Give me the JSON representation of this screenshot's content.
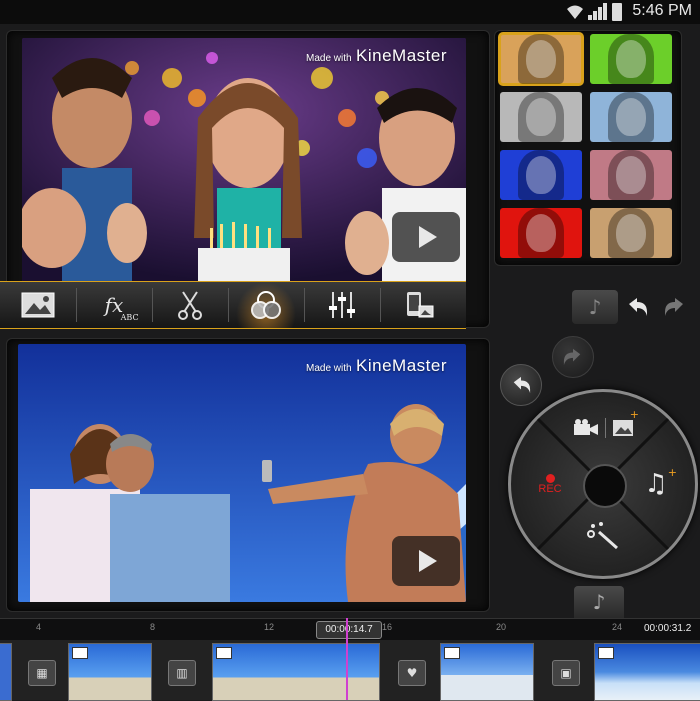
{
  "status_bar": {
    "time": "5:46 PM",
    "icons": [
      "wifi-icon",
      "signal-icon",
      "battery-icon"
    ]
  },
  "top_preview": {
    "watermark_small": "Made with",
    "watermark_brand": "KineMaster",
    "play_icon": "play-icon"
  },
  "bottom_preview": {
    "watermark_small": "Made with",
    "watermark_brand": "KineMaster",
    "play_icon": "play-icon"
  },
  "color_filters": [
    {
      "name": "original",
      "color": "#d9a25a",
      "selected": true
    },
    {
      "name": "green",
      "color": "#6ccf2a"
    },
    {
      "name": "grayscale",
      "color": "#b8b8b8"
    },
    {
      "name": "light-blue",
      "color": "#8fb4d9"
    },
    {
      "name": "blue",
      "color": "#1f3fd6"
    },
    {
      "name": "rose",
      "color": "#c07a86"
    },
    {
      "name": "red",
      "color": "#e0140e"
    },
    {
      "name": "warm",
      "color": "#c8a070"
    }
  ],
  "toolbar": {
    "tools": [
      "image-icon",
      "fx-text-icon",
      "scissors-icon",
      "color-filter-icon",
      "adjust-sliders-icon",
      "pan-zoom-icon"
    ],
    "fx_label": "fx",
    "fx_sub": "ABC"
  },
  "dial": {
    "rec_label": "REC"
  },
  "timeline": {
    "current_time": "00:00:14.7",
    "total_time": "00:00:31.2",
    "ruler_ticks": [
      "4",
      "8",
      "12",
      "16",
      "20",
      "24"
    ]
  },
  "colors": {
    "accent": "#d9a21b",
    "rec": "#e02020",
    "playhead": "#d040d0"
  }
}
